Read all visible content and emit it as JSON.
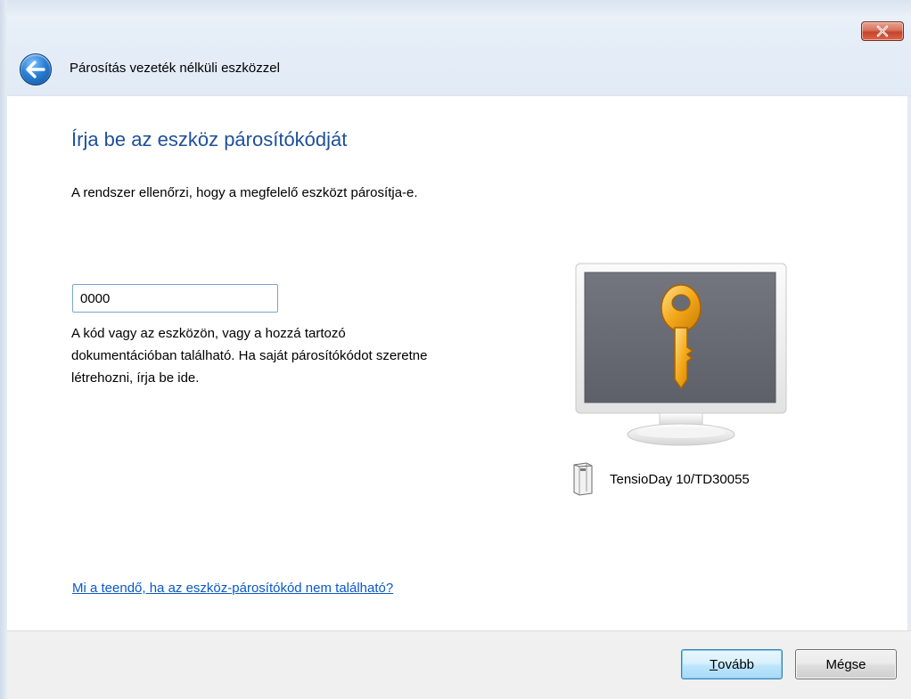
{
  "window": {
    "title": "Párosítás vezeték nélküli eszközzel"
  },
  "content": {
    "heading": "Írja be az eszköz párosítókódját",
    "description": "A rendszer ellenőrzi, hogy a megfelelő eszközt párosítja-e.",
    "passcode_value": "0000",
    "hint_line1": "A kód vagy az eszközön, vagy a hozzá tartozó",
    "hint_line2": "dokumentációban található. Ha saját párosítókódot szeretne",
    "hint_line3": "létrehozni, írja be ide.",
    "device_name": "TensioDay 10/TD30055",
    "help_link": "Mi a teendő, ha az eszköz-párosítókód nem található?"
  },
  "footer": {
    "next_accel": "T",
    "next_rest": "ovább",
    "cancel_label": "Mégse"
  },
  "icons": {
    "back": "back-arrow-icon",
    "close": "close-icon",
    "key": "key-icon",
    "device": "device-icon"
  },
  "colors": {
    "heading": "#1e4f9c",
    "link": "#0a58c8",
    "close_button": "#c7432b",
    "key_gold": "#f0a500",
    "monitor_screen": "#6a6c75"
  }
}
